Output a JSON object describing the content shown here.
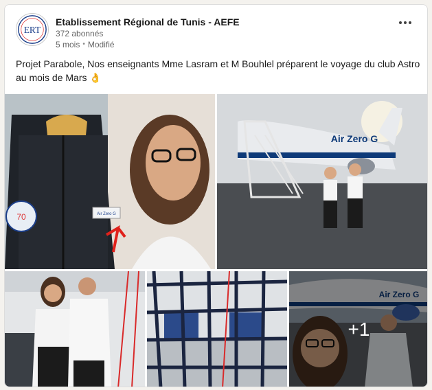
{
  "post": {
    "org_name": "Etablissement Régional de Tunis - AEFE",
    "logo_text": "ERT",
    "followers": "372  abonnés",
    "time": "5 mois",
    "separator": "•",
    "edited": "Modifié",
    "more_icon": "more-horizontal-icon",
    "caption": "Projet Parabole, Nos enseignants Mme Lasram et M Bouhlel préparent le voyage du club Astro au mois de Mars 👌"
  },
  "photos": {
    "p1_badge": "Air Zero G",
    "p1_patch": "70",
    "p2_livery": "Air Zero G",
    "p5_livery": "Air Zero G",
    "more_count": "+1"
  },
  "colors": {
    "card_bg": "#ffffff",
    "page_bg": "#f4f2ee",
    "text_primary": "#191919",
    "text_secondary": "#666666"
  }
}
